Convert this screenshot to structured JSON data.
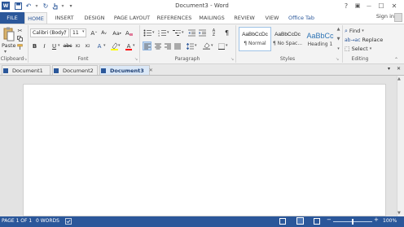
{
  "window": {
    "title": "Document3 - Word"
  },
  "quick_access": {
    "undo": "↶",
    "redo": "↻",
    "customize": "▾"
  },
  "window_controls": {
    "help": "?",
    "ribbon_options": "▣",
    "minimize": "—",
    "maximize": "☐",
    "close": "✕"
  },
  "ribbon_tabs": [
    "FILE",
    "HOME",
    "INSERT",
    "DESIGN",
    "PAGE LAYOUT",
    "REFERENCES",
    "MAILINGS",
    "REVIEW",
    "VIEW",
    "Office Tab"
  ],
  "sign_in": "Sign in",
  "clipboard": {
    "paste": "Paste",
    "label": "Clipboard"
  },
  "font": {
    "name": "Calibri (Body)",
    "size": "11",
    "label": "Font"
  },
  "paragraph": {
    "label": "Paragraph"
  },
  "styles": {
    "label": "Styles",
    "items": [
      {
        "preview": "AaBbCcDc",
        "name": "¶ Normal"
      },
      {
        "preview": "AaBbCcDc",
        "name": "¶ No Spac..."
      },
      {
        "preview": "AaBbCc",
        "name": "Heading 1"
      }
    ]
  },
  "editing": {
    "find": "Find",
    "replace": "Replace",
    "select": "Select",
    "label": "Editing"
  },
  "doc_tabs": [
    "Document1",
    "Document2",
    "Document3"
  ],
  "status": {
    "page": "PAGE 1 OF 1",
    "words": "0 WORDS",
    "zoom": "100%"
  },
  "colors": {
    "accent": "#2b579a",
    "ribbon_bg": "#f3f3f3",
    "doc_bg": "#e3e3e3",
    "highlight": "#ffff00",
    "font_color": "#ff0000"
  }
}
